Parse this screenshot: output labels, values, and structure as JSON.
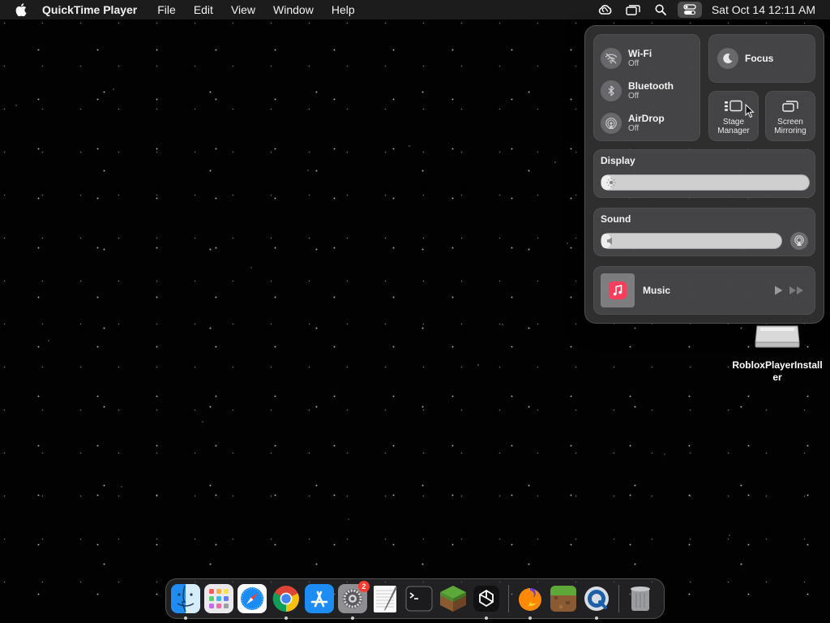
{
  "menubar": {
    "app_name": "QuickTime Player",
    "menus": [
      "File",
      "Edit",
      "View",
      "Window",
      "Help"
    ],
    "status_icons": [
      "creative-cloud-icon",
      "screen-mirror-icon",
      "spotlight-search-icon",
      "control-center-icon"
    ],
    "clock": "Sat Oct 14  12:11 AM"
  },
  "control_center": {
    "wifi": {
      "label": "Wi-Fi",
      "status": "Off"
    },
    "bluetooth": {
      "label": "Bluetooth",
      "status": "Off"
    },
    "airdrop": {
      "label": "AirDrop",
      "status": "Off"
    },
    "focus": {
      "label": "Focus"
    },
    "stage_manager": {
      "label": "Stage Manager"
    },
    "screen_mirroring": {
      "label": "Screen Mirroring"
    },
    "display": {
      "label": "Display",
      "brightness": 0.05
    },
    "sound": {
      "label": "Sound",
      "volume": 0.05
    },
    "now_playing": {
      "label": "Music"
    }
  },
  "desktop": {
    "icon_label": "RobloxPlayerInstaller"
  },
  "dock": {
    "apps": [
      "Finder",
      "Launchpad",
      "Safari",
      "Google Chrome",
      "App Store",
      "System Settings",
      "TextEdit",
      "Terminal",
      "Minecraft",
      "ChatGPT",
      "Firefox",
      "Minecraft Launcher",
      "QuickTime Player"
    ],
    "trash": "Trash",
    "settings_badge": "2"
  },
  "colors": {
    "accent_red": "#ff3b30",
    "panel_bg": "#343436",
    "menubar_bg": "#1e1e20"
  }
}
